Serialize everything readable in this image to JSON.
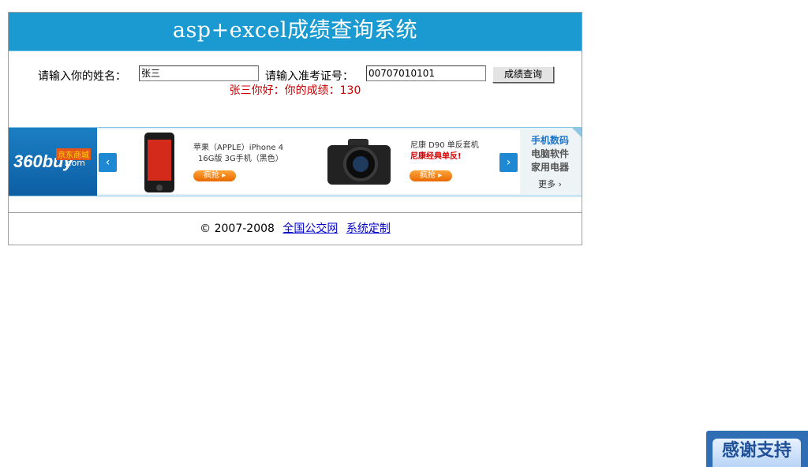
{
  "header": {
    "title": "asp+excel成绩查询系统"
  },
  "form": {
    "name_label": "请输入你的姓名：",
    "name_value": "张三",
    "id_label": "请输入准考证号：",
    "id_value": "00707010101",
    "submit_label": "成绩查询"
  },
  "result": {
    "text": "张三你好：你的成绩：130"
  },
  "ad": {
    "logo_text": "360buy",
    "logo_tag": "京东商城",
    "logo_com": ".com",
    "product1": {
      "line1": "苹果（APPLE）iPhone 4",
      "line2": "16G版 3G手机（黑色）",
      "buy_label": "疯抢 ▸"
    },
    "product2": {
      "line1": "尼康 D90 单反套机",
      "line2": "尼康经典单反!",
      "buy_label": "疯抢 ▸"
    },
    "side": [
      "手机数码",
      "电脑软件",
      "家用电器"
    ],
    "more_label": "更多 ›"
  },
  "footer": {
    "copyright": "© 2007-2008",
    "link1": "全国公交网",
    "link2": "系统定制"
  },
  "thanks": {
    "label": "感谢支持"
  }
}
